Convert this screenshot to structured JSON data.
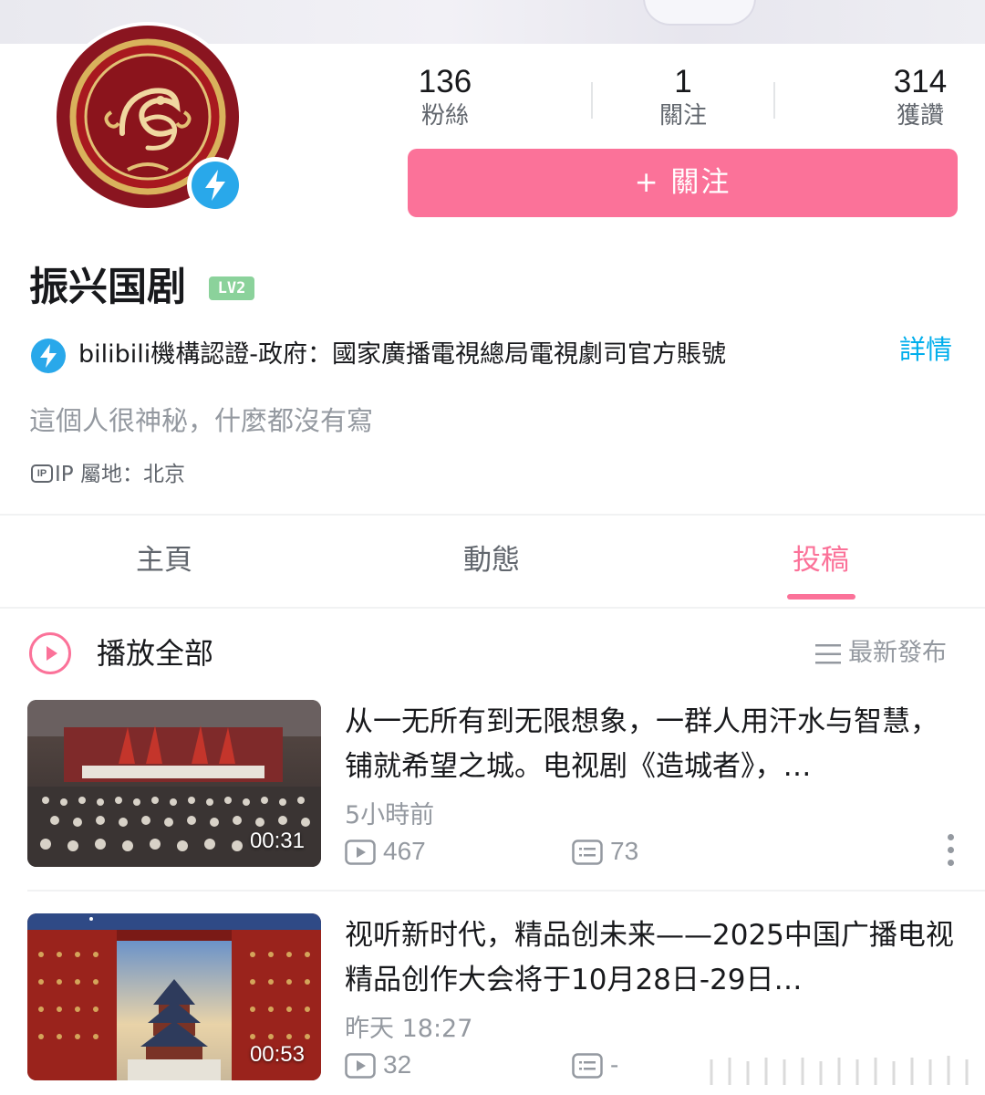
{
  "profile": {
    "username": "振兴国剧",
    "level": "LV2",
    "certification": "bilibili機構認證-政府：國家廣播電視總局電視劇司官方賬號",
    "detail_link": "詳情",
    "bio": "這個人很神秘，什麼都沒有寫",
    "ip_badge": "IP",
    "ip_location": "IP 屬地：北京",
    "avatar_icon": "phoenix-emblem-avatar",
    "verify_icon": "lightning-verified-icon"
  },
  "stats": {
    "fans_count": "136",
    "fans_label": "粉絲",
    "following_count": "1",
    "following_label": "關注",
    "likes_count": "314",
    "likes_label": "獲讚"
  },
  "follow_button": {
    "label": "+ 關注"
  },
  "tabs": [
    {
      "label": "主頁",
      "active": false
    },
    {
      "label": "動態",
      "active": false
    },
    {
      "label": "投稿",
      "active": true
    }
  ],
  "list_header": {
    "play_all": "播放全部",
    "sort": "最新發布"
  },
  "videos": [
    {
      "title": "从一无所有到无限想象，一群人用汗水与智慧，铺就希望之城。电视剧《造城者》，…",
      "duration": "00:31",
      "time": "5小時前",
      "plays": "467",
      "comments": "73"
    },
    {
      "title": "视听新时代，精品创未来——2025中国广播电视精品创作大会将于10月28日-29日…",
      "duration": "00:53",
      "time": "昨天 18:27",
      "plays": "32",
      "comments": "-"
    }
  ],
  "colors": {
    "accent_pink": "#fb7299",
    "verified_blue": "#29a8ea",
    "link_blue": "#00aeec",
    "level_green": "#8bd29b",
    "text_gray": "#9499a0"
  }
}
